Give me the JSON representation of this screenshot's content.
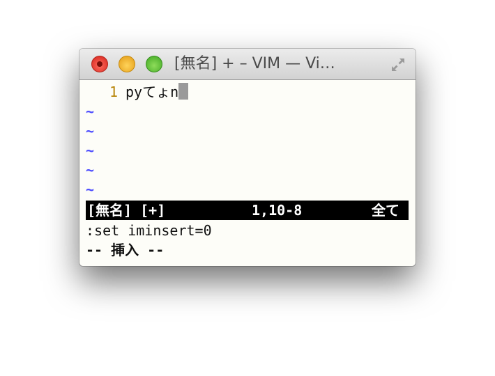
{
  "window": {
    "title": "[無名] + – VIM — Vi…"
  },
  "editor": {
    "line_number": "1",
    "line_text": "pyてょn",
    "tildes": [
      "~",
      "~",
      "~",
      "~",
      "~"
    ]
  },
  "statusline": {
    "file": "[無名] [+]",
    "position": "1,10-8",
    "scroll": "全て"
  },
  "command_line": ":set iminsert=0",
  "mode_indicator": "-- 挿入 --",
  "colors": {
    "line_number": "#b8860b",
    "tilde": "#4b4bff",
    "statusline_bg": "#000000",
    "cursor": "#9a9a9a"
  }
}
